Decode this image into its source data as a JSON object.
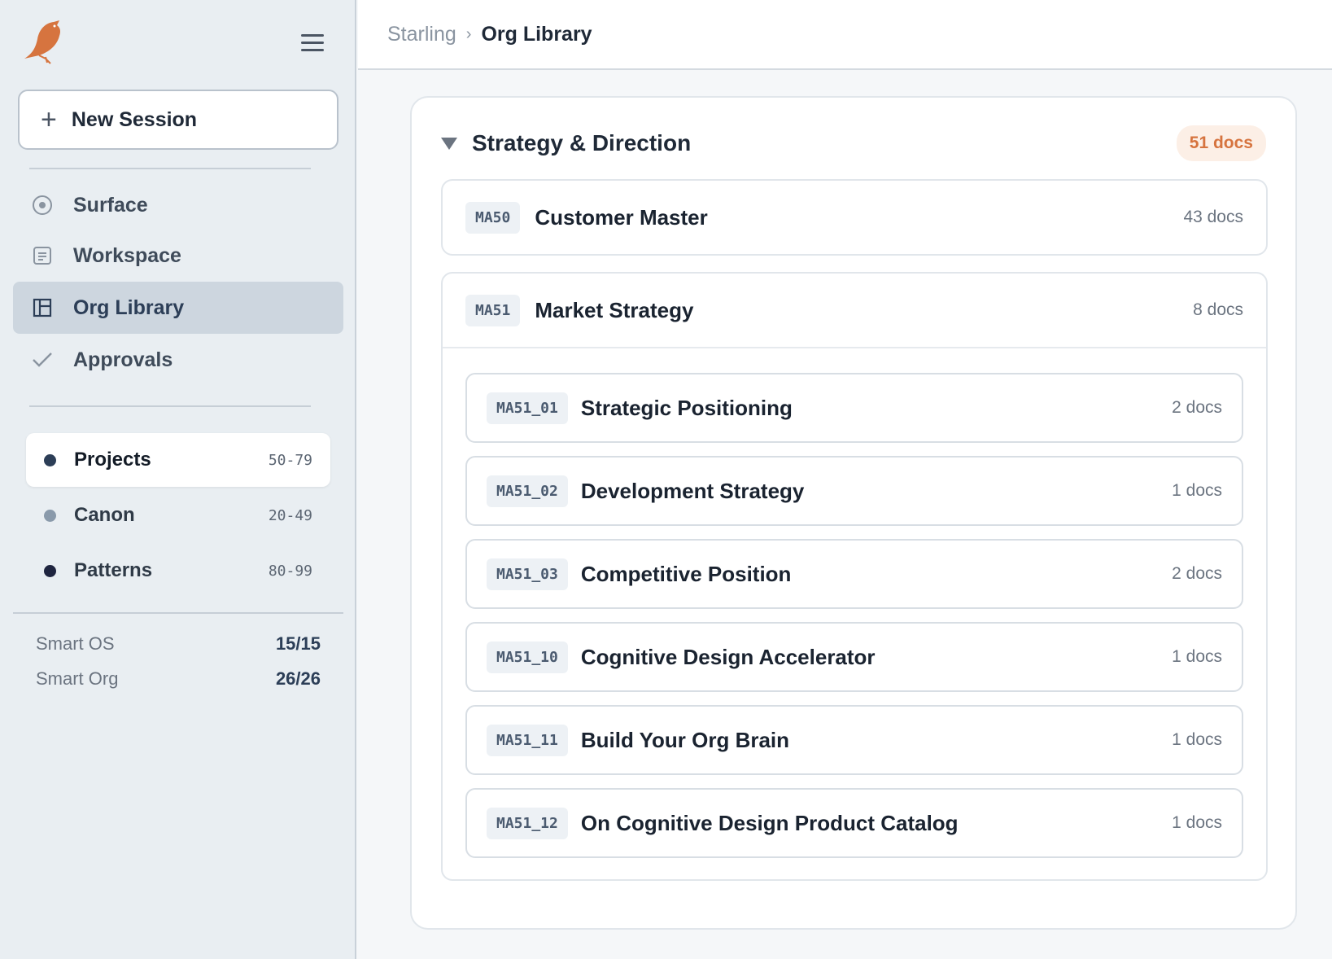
{
  "app": {
    "name": "Starling"
  },
  "sidebar": {
    "new_session_label": "New Session",
    "nav": [
      {
        "label": "Surface",
        "icon": "circle-dot-icon"
      },
      {
        "label": "Workspace",
        "icon": "document-icon"
      },
      {
        "label": "Org Library",
        "icon": "library-icon",
        "active": true
      },
      {
        "label": "Approvals",
        "icon": "check-icon"
      }
    ],
    "categories": [
      {
        "label": "Projects",
        "range": "50-79",
        "color": "#2c3e57",
        "active": true
      },
      {
        "label": "Canon",
        "range": "20-49",
        "color": "#8a9aab"
      },
      {
        "label": "Patterns",
        "range": "80-99",
        "color": "#1f2540"
      }
    ],
    "stats": [
      {
        "label": "Smart OS",
        "value": "15/15"
      },
      {
        "label": "Smart Org",
        "value": "26/26"
      }
    ]
  },
  "header": {
    "breadcrumb_root": "Starling",
    "breadcrumb_sep": "›",
    "breadcrumb_current": "Org Library"
  },
  "section": {
    "title": "Strategy & Direction",
    "count": "51 docs",
    "groups": [
      {
        "code": "MA50",
        "title": "Customer Master",
        "count": "43 docs"
      },
      {
        "code": "MA51",
        "title": "Market Strategy",
        "count": "8 docs",
        "children": [
          {
            "code": "MA51_01",
            "title": "Strategic Positioning",
            "count": "2 docs"
          },
          {
            "code": "MA51_02",
            "title": "Development Strategy",
            "count": "1 docs"
          },
          {
            "code": "MA51_03",
            "title": "Competitive Position",
            "count": "2 docs"
          },
          {
            "code": "MA51_10",
            "title": "Cognitive Design Accelerator",
            "count": "1 docs"
          },
          {
            "code": "MA51_11",
            "title": "Build Your Org Brain",
            "count": "1 docs"
          },
          {
            "code": "MA51_12",
            "title": "On Cognitive Design Product Catalog",
            "count": "1 docs"
          }
        ]
      }
    ]
  },
  "colors": {
    "accent": "#d6743f",
    "active_nav": "#cdd6df",
    "sidebar_bg": "#e9eef2"
  }
}
